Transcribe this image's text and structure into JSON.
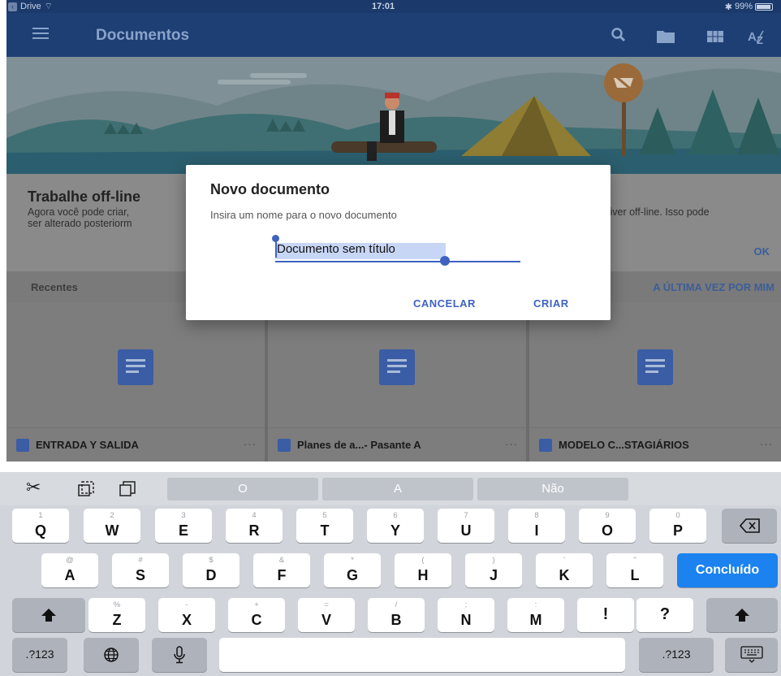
{
  "status_bar": {
    "back_app": "Drive",
    "time": "17:01",
    "battery": "99%"
  },
  "app_bar": {
    "title": "Documentos"
  },
  "info_card": {
    "title": "Trabalhe off-line",
    "body_line1": "Agora você pode criar, ",
    "body_line2": "ser alterado posteriorm",
    "body_right": "tiver off-line. Isso pode",
    "ok": "OK"
  },
  "section": {
    "left": "Recentes",
    "right": "A ÚLTIMA VEZ POR MIM"
  },
  "files": [
    {
      "name": "ENTRADA Y SALIDA",
      "more": "···"
    },
    {
      "name": "Planes de a...- Pasante A",
      "more": "···"
    },
    {
      "name": "MODELO C...STAGIÁRIOS",
      "more": "···"
    }
  ],
  "dialog": {
    "title": "Novo documento",
    "subtitle": "Insira um nome para o novo documento",
    "field_value": "Documento sem título",
    "cancel": "CANCELAR",
    "create": "CRIAR"
  },
  "keyboard": {
    "suggestions": [
      "O",
      "A",
      "Não"
    ],
    "row1": [
      {
        "hint": "1",
        "key": "Q"
      },
      {
        "hint": "2",
        "key": "W"
      },
      {
        "hint": "3",
        "key": "E"
      },
      {
        "hint": "4",
        "key": "R"
      },
      {
        "hint": "5",
        "key": "T"
      },
      {
        "hint": "6",
        "key": "Y"
      },
      {
        "hint": "7",
        "key": "U"
      },
      {
        "hint": "8",
        "key": "I"
      },
      {
        "hint": "9",
        "key": "O"
      },
      {
        "hint": "0",
        "key": "P"
      }
    ],
    "row2": [
      {
        "hint": "@",
        "key": "A"
      },
      {
        "hint": "#",
        "key": "S"
      },
      {
        "hint": "$",
        "key": "D"
      },
      {
        "hint": "&",
        "key": "F"
      },
      {
        "hint": "*",
        "key": "G"
      },
      {
        "hint": "(",
        "key": "H"
      },
      {
        "hint": ")",
        "key": "J"
      },
      {
        "hint": "'",
        "key": "K"
      },
      {
        "hint": "\"",
        "key": "L"
      }
    ],
    "row3": [
      {
        "hint": "%",
        "key": "Z"
      },
      {
        "hint": "-",
        "key": "X"
      },
      {
        "hint": "+",
        "key": "C"
      },
      {
        "hint": "=",
        "key": "V"
      },
      {
        "hint": "/",
        "key": "B"
      },
      {
        "hint": ";",
        "key": "N"
      },
      {
        "hint": ":",
        "key": "M"
      },
      {
        "hint": "",
        "key": "!"
      },
      {
        "hint": "",
        "key": "?"
      }
    ],
    "return_label": "Concluído",
    "numbers_label": ".?123"
  }
}
